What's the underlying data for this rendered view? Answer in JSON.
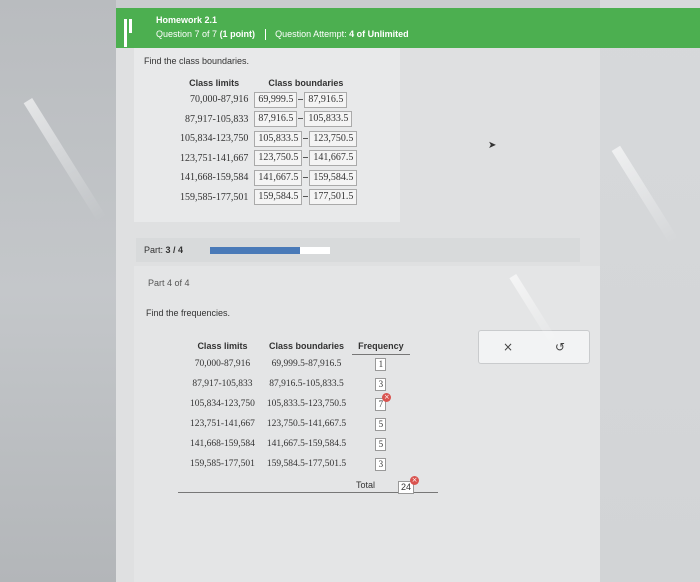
{
  "header": {
    "title": "Homework 2.1",
    "question_prefix": "Question 7 of 7",
    "points": "(1 point)",
    "attempt_prefix": "Question Attempt:",
    "attempt_value": "4 of Unlimited"
  },
  "part_prev": {
    "instruction": "Find the class boundaries.",
    "headers": [
      "Class limits",
      "Class boundaries"
    ],
    "rows": [
      {
        "limits": "70,000-87,916",
        "low": "69,999.5",
        "high": "87,916.5"
      },
      {
        "limits": "87,917-105,833",
        "low": "87,916.5",
        "high": "105,833.5"
      },
      {
        "limits": "105,834-123,750",
        "low": "105,833.5",
        "high": "123,750.5"
      },
      {
        "limits": "123,751-141,667",
        "low": "123,750.5",
        "high": "141,667.5"
      },
      {
        "limits": "141,668-159,584",
        "low": "141,667.5",
        "high": "159,584.5"
      },
      {
        "limits": "159,585-177,501",
        "low": "159,584.5",
        "high": "177,501.5"
      }
    ]
  },
  "progress": {
    "label": "Part:",
    "value": "3 / 4",
    "fraction": 0.75
  },
  "part_current": {
    "label": "Part 4 of 4",
    "instruction": "Find the frequencies.",
    "headers": [
      "Class limits",
      "Class boundaries",
      "Frequency"
    ],
    "rows": [
      {
        "limits": "70,000-87,916",
        "boundaries": "69,999.5-87,916.5",
        "freq": "1",
        "wrong": false
      },
      {
        "limits": "87,917-105,833",
        "boundaries": "87,916.5-105,833.5",
        "freq": "3",
        "wrong": false
      },
      {
        "limits": "105,834-123,750",
        "boundaries": "105,833.5-123,750.5",
        "freq": "7",
        "wrong": true
      },
      {
        "limits": "123,751-141,667",
        "boundaries": "123,750.5-141,667.5",
        "freq": "5",
        "wrong": false
      },
      {
        "limits": "141,668-159,584",
        "boundaries": "141,667.5-159,584.5",
        "freq": "5",
        "wrong": false
      },
      {
        "limits": "159,585-177,501",
        "boundaries": "159,584.5-177,501.5",
        "freq": "3",
        "wrong": false
      }
    ],
    "total_label": "Total",
    "total_value": "24",
    "total_wrong": true
  },
  "actions": {
    "clear_icon": "×",
    "undo_icon": "↺"
  },
  "icons": {
    "menu": "menu-icon",
    "clear": "close-icon",
    "undo": "undo-icon",
    "error": "error-x-icon"
  },
  "colors": {
    "header": "#4caf50",
    "progress": "#4a7ab8",
    "error": "#d9534f"
  }
}
